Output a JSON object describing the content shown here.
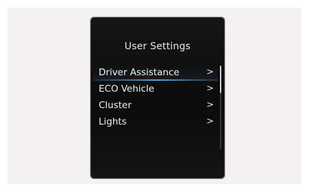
{
  "screen": {
    "title": "User Settings"
  },
  "menu": {
    "items": [
      {
        "label": "Driver Assistance",
        "chevron": ">",
        "selected": true
      },
      {
        "label": "ECO Vehicle",
        "chevron": ">",
        "selected": false
      },
      {
        "label": "Cluster",
        "chevron": ">",
        "selected": false
      },
      {
        "label": "Lights",
        "chevron": ">",
        "selected": false
      }
    ]
  },
  "colors": {
    "screen_background": "#0b0b0b",
    "text": "#f2f2f2",
    "selection_accent": "#5aa9e6",
    "page_background": "#f3f1f1"
  },
  "scroll": {
    "position_fraction": 0.0,
    "visible_fraction": 0.33
  }
}
